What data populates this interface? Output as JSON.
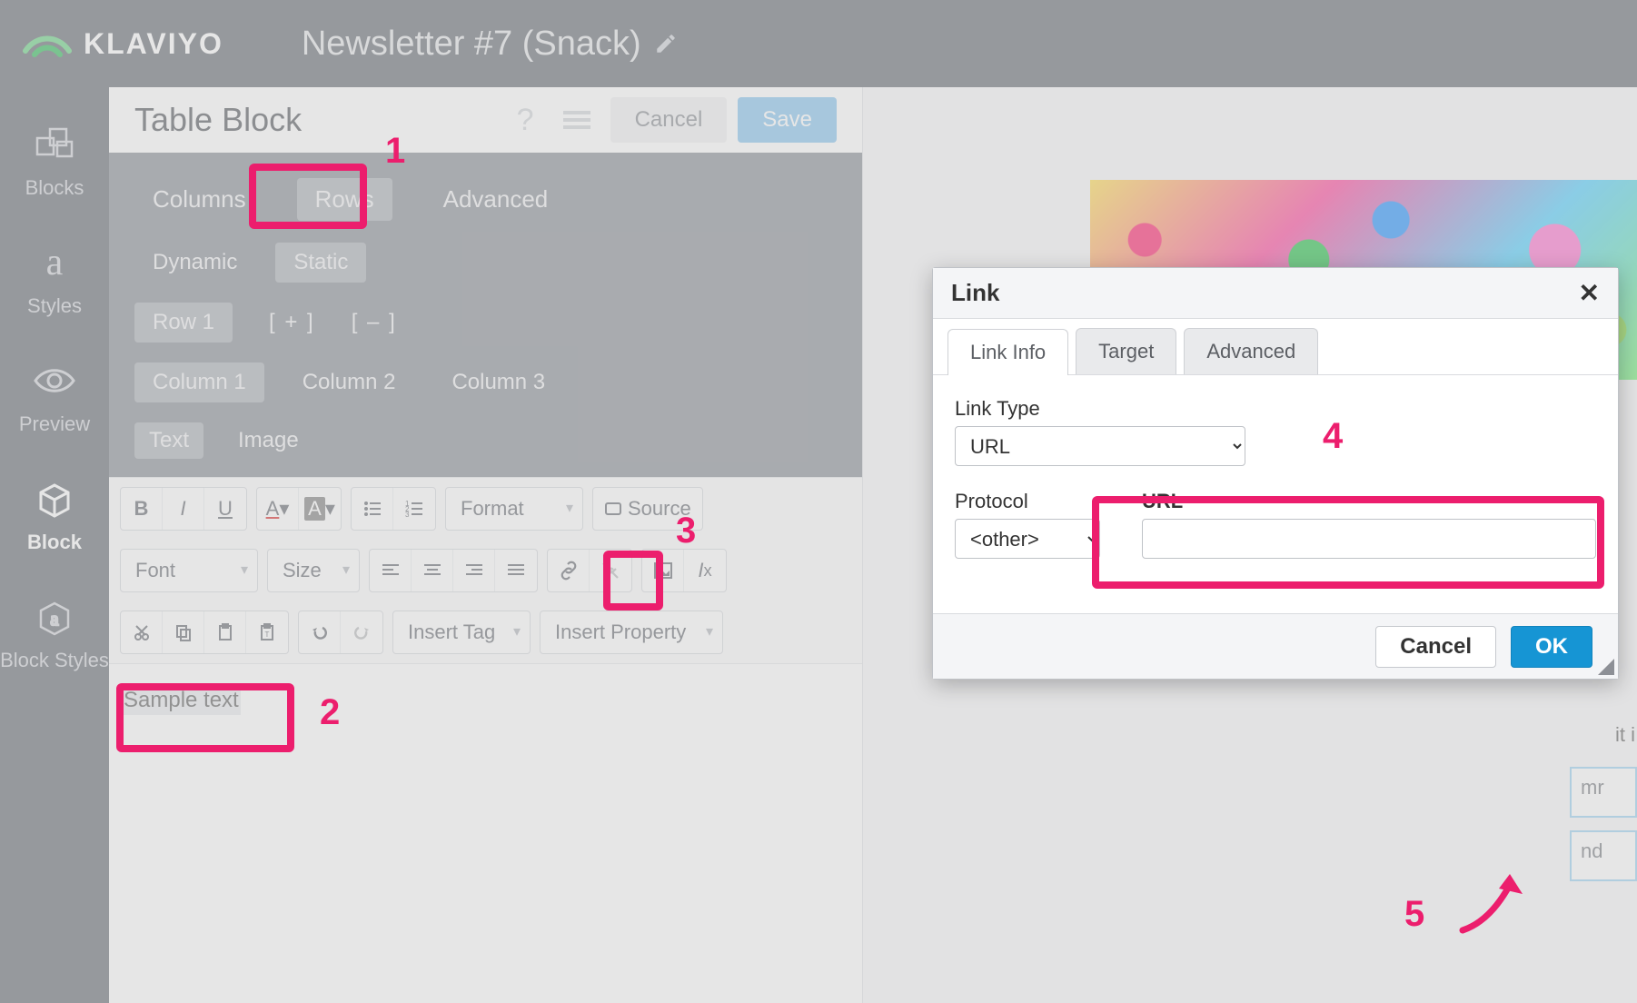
{
  "brand": {
    "name": "KLAVIYO"
  },
  "document": {
    "title": "Newsletter #7 (Snack)"
  },
  "sidebar": {
    "items": [
      {
        "label": "Blocks"
      },
      {
        "label": "Styles"
      },
      {
        "label": "Preview"
      },
      {
        "label": "Block"
      },
      {
        "label": "Block Styles"
      }
    ],
    "active_index": 3
  },
  "editor": {
    "panel_title": "Table Block",
    "buttons": {
      "cancel": "Cancel",
      "save": "Save"
    },
    "structure_tabs": [
      "Columns",
      "Rows",
      "Advanced"
    ],
    "structure_active": 1,
    "mode_tabs": [
      "Dynamic",
      "Static"
    ],
    "mode_active": 1,
    "rows": {
      "active": "Row 1",
      "add": "[ + ]",
      "remove": "[ – ]"
    },
    "columns": [
      "Column 1",
      "Column 2",
      "Column 3"
    ],
    "columns_active": 0,
    "content_tabs": [
      "Text",
      "Image"
    ],
    "content_active": 0
  },
  "toolbar": {
    "format": "Format",
    "source": "Source",
    "font": "Font",
    "size": "Size",
    "insert_tag": "Insert Tag",
    "insert_property": "Insert Property"
  },
  "canvas": {
    "sample_text": "Sample text"
  },
  "right": {
    "fragment1": "it i",
    "col_box1": "mr",
    "col_box2": "nd"
  },
  "dialog": {
    "title": "Link",
    "tabs": [
      "Link Info",
      "Target",
      "Advanced"
    ],
    "active_tab": 0,
    "link_type_label": "Link Type",
    "link_type_value": "URL",
    "protocol_label": "Protocol",
    "protocol_value": "<other>",
    "url_label": "URL",
    "url_value": "",
    "cancel": "Cancel",
    "ok": "OK"
  },
  "annotations": {
    "n1": "1",
    "n2": "2",
    "n3": "3",
    "n4": "4",
    "n5": "5"
  }
}
